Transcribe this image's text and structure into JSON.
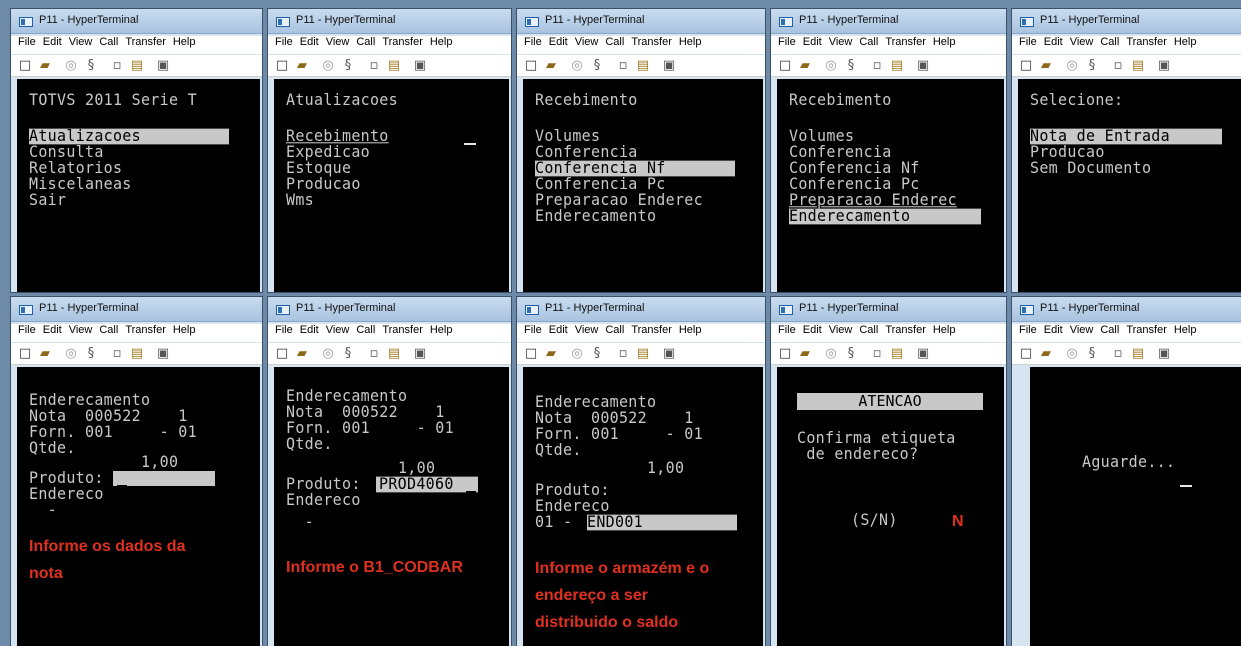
{
  "title": "P11 - HyperTerminal",
  "menu": [
    "File",
    "Edit",
    "View",
    "Call",
    "Transfer",
    "Help"
  ],
  "windows": [
    {
      "lines": [
        "TOTVS 2011 Serie T",
        "",
        "Atualizacoes",
        "Consulta",
        "Relatorios",
        "Miscelaneas",
        "Sair"
      ]
    },
    {
      "lines": [
        "Atualizacoes",
        "",
        "Recebimento",
        "Expedicao",
        "Estoque",
        "Producao",
        "Wms"
      ]
    },
    {
      "lines": [
        "Recebimento",
        "",
        "Volumes",
        "Conferencia",
        "Conferencia Nf",
        "Conferencia Pc",
        "Preparacao Enderec",
        "Enderecamento"
      ]
    },
    {
      "lines": [
        "Recebimento",
        "",
        "Volumes",
        "Conferencia",
        "Conferencia Nf",
        "Conferencia Pc",
        "Preparacao Enderec",
        "Enderecamento"
      ]
    },
    {
      "lines": [
        "Selecione:",
        "",
        "Nota de Entrada",
        "Producao",
        "Sem Documento"
      ]
    },
    {
      "lines": [
        "Enderecamento",
        "Nota  000522    1",
        "Forn. 001     - 01",
        "Qtde.",
        "            1,00",
        "Produto:",
        "Endereco",
        "  -"
      ],
      "note": [
        "Informe os dados da",
        "nota"
      ]
    },
    {
      "lines": [
        "Enderecamento",
        "Nota  000522    1",
        "Forn. 001     - 01",
        "Qtde.",
        "            1,00",
        "Produto:",
        "Endereco",
        "  -"
      ],
      "field_value": "PROD4060",
      "note": [
        "Informe o B1_CODBAR"
      ]
    },
    {
      "lines": [
        "Enderecamento",
        "Nota  000522    1",
        "Forn. 001     - 01",
        "Qtde.",
        "            1,00",
        "Produto:",
        "Endereco",
        "01 - "
      ],
      "field_value": "END001",
      "note": [
        "Informe o armazém e o",
        "endereço a ser",
        "distribuido o saldo"
      ]
    },
    {
      "header": "ATENCAO",
      "lines": [
        "Confirma etiqueta",
        " de endereco?",
        "(S/N)"
      ],
      "answer": "N"
    },
    {
      "lines": [
        "Aguarde..."
      ]
    }
  ]
}
